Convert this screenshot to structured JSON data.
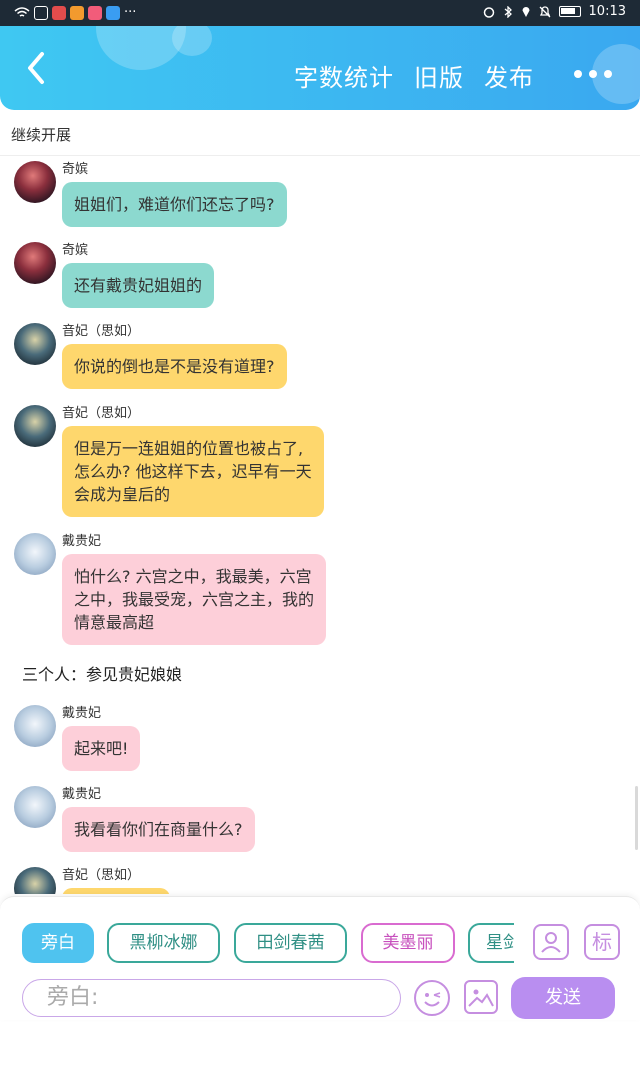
{
  "status_bar": {
    "time": "10:13",
    "dots": "···"
  },
  "header": {
    "actions": [
      "字数统计",
      "旧版",
      "发布"
    ]
  },
  "subtitle": "继续开展",
  "messages": [
    {
      "sender": "奇嫔",
      "text": "姐姐们，难道你们还忘了吗?"
    },
    {
      "sender": "奇嫔",
      "text": "还有戴贵妃姐姐的"
    },
    {
      "sender": "音妃（思如）",
      "text": "你说的倒也是不是没有道理?"
    },
    {
      "sender": "音妃（思如）",
      "lines": [
        "但是万一连姐姐的位置也被占了,",
        "怎么办? 他这样下去，迟早有一天",
        "会成为皇后的"
      ]
    },
    {
      "sender": "戴贵妃",
      "lines": [
        "怕什么? 六宫之中，我最美，六宫",
        "之中，我最受宠，六宫之主，我的",
        "情意最高超"
      ]
    },
    {
      "narration": "三个人：参见贵妃娘娘"
    },
    {
      "sender": "戴贵妃",
      "text": "起来吧!"
    },
    {
      "sender": "戴贵妃",
      "text": "我看看你们在商量什么?"
    },
    {
      "sender": "音妃（思如）",
      "text": ""
    }
  ],
  "roles": [
    "旁白",
    "黑柳冰娜",
    "田剑春茜",
    "美墨丽",
    "星剑"
  ],
  "input": {
    "placeholder": "旁白:"
  },
  "send_label": "发送",
  "colors": {
    "header": "#3aa8f0",
    "teal": "#8cd9cf",
    "yellow": "#fed76d",
    "pink": "#fdcfd9",
    "send": "#b98ef0"
  }
}
